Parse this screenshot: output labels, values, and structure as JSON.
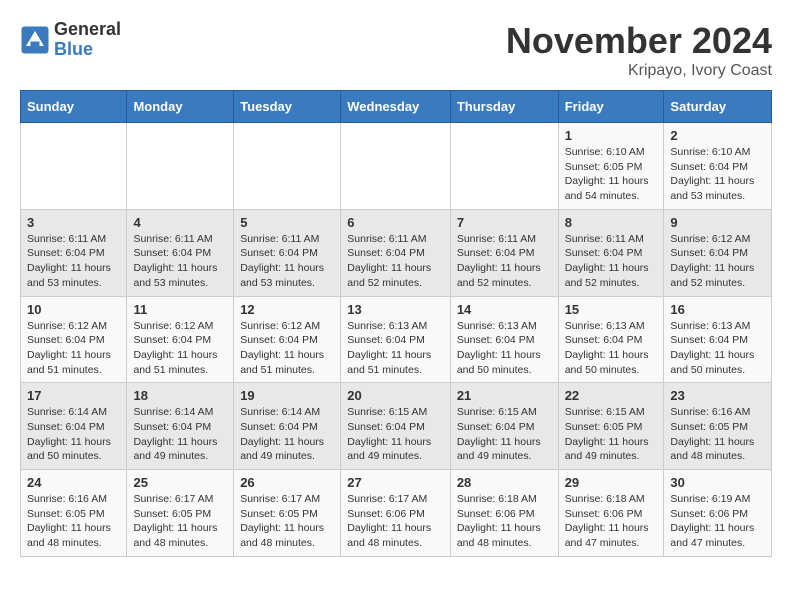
{
  "logo": {
    "general": "General",
    "blue": "Blue"
  },
  "title": "November 2024",
  "location": "Kripayo, Ivory Coast",
  "headers": [
    "Sunday",
    "Monday",
    "Tuesday",
    "Wednesday",
    "Thursday",
    "Friday",
    "Saturday"
  ],
  "weeks": [
    [
      {
        "day": "",
        "detail": ""
      },
      {
        "day": "",
        "detail": ""
      },
      {
        "day": "",
        "detail": ""
      },
      {
        "day": "",
        "detail": ""
      },
      {
        "day": "",
        "detail": ""
      },
      {
        "day": "1",
        "detail": "Sunrise: 6:10 AM\nSunset: 6:05 PM\nDaylight: 11 hours and 54 minutes."
      },
      {
        "day": "2",
        "detail": "Sunrise: 6:10 AM\nSunset: 6:04 PM\nDaylight: 11 hours and 53 minutes."
      }
    ],
    [
      {
        "day": "3",
        "detail": "Sunrise: 6:11 AM\nSunset: 6:04 PM\nDaylight: 11 hours and 53 minutes."
      },
      {
        "day": "4",
        "detail": "Sunrise: 6:11 AM\nSunset: 6:04 PM\nDaylight: 11 hours and 53 minutes."
      },
      {
        "day": "5",
        "detail": "Sunrise: 6:11 AM\nSunset: 6:04 PM\nDaylight: 11 hours and 53 minutes."
      },
      {
        "day": "6",
        "detail": "Sunrise: 6:11 AM\nSunset: 6:04 PM\nDaylight: 11 hours and 52 minutes."
      },
      {
        "day": "7",
        "detail": "Sunrise: 6:11 AM\nSunset: 6:04 PM\nDaylight: 11 hours and 52 minutes."
      },
      {
        "day": "8",
        "detail": "Sunrise: 6:11 AM\nSunset: 6:04 PM\nDaylight: 11 hours and 52 minutes."
      },
      {
        "day": "9",
        "detail": "Sunrise: 6:12 AM\nSunset: 6:04 PM\nDaylight: 11 hours and 52 minutes."
      }
    ],
    [
      {
        "day": "10",
        "detail": "Sunrise: 6:12 AM\nSunset: 6:04 PM\nDaylight: 11 hours and 51 minutes."
      },
      {
        "day": "11",
        "detail": "Sunrise: 6:12 AM\nSunset: 6:04 PM\nDaylight: 11 hours and 51 minutes."
      },
      {
        "day": "12",
        "detail": "Sunrise: 6:12 AM\nSunset: 6:04 PM\nDaylight: 11 hours and 51 minutes."
      },
      {
        "day": "13",
        "detail": "Sunrise: 6:13 AM\nSunset: 6:04 PM\nDaylight: 11 hours and 51 minutes."
      },
      {
        "day": "14",
        "detail": "Sunrise: 6:13 AM\nSunset: 6:04 PM\nDaylight: 11 hours and 50 minutes."
      },
      {
        "day": "15",
        "detail": "Sunrise: 6:13 AM\nSunset: 6:04 PM\nDaylight: 11 hours and 50 minutes."
      },
      {
        "day": "16",
        "detail": "Sunrise: 6:13 AM\nSunset: 6:04 PM\nDaylight: 11 hours and 50 minutes."
      }
    ],
    [
      {
        "day": "17",
        "detail": "Sunrise: 6:14 AM\nSunset: 6:04 PM\nDaylight: 11 hours and 50 minutes."
      },
      {
        "day": "18",
        "detail": "Sunrise: 6:14 AM\nSunset: 6:04 PM\nDaylight: 11 hours and 49 minutes."
      },
      {
        "day": "19",
        "detail": "Sunrise: 6:14 AM\nSunset: 6:04 PM\nDaylight: 11 hours and 49 minutes."
      },
      {
        "day": "20",
        "detail": "Sunrise: 6:15 AM\nSunset: 6:04 PM\nDaylight: 11 hours and 49 minutes."
      },
      {
        "day": "21",
        "detail": "Sunrise: 6:15 AM\nSunset: 6:04 PM\nDaylight: 11 hours and 49 minutes."
      },
      {
        "day": "22",
        "detail": "Sunrise: 6:15 AM\nSunset: 6:05 PM\nDaylight: 11 hours and 49 minutes."
      },
      {
        "day": "23",
        "detail": "Sunrise: 6:16 AM\nSunset: 6:05 PM\nDaylight: 11 hours and 48 minutes."
      }
    ],
    [
      {
        "day": "24",
        "detail": "Sunrise: 6:16 AM\nSunset: 6:05 PM\nDaylight: 11 hours and 48 minutes."
      },
      {
        "day": "25",
        "detail": "Sunrise: 6:17 AM\nSunset: 6:05 PM\nDaylight: 11 hours and 48 minutes."
      },
      {
        "day": "26",
        "detail": "Sunrise: 6:17 AM\nSunset: 6:05 PM\nDaylight: 11 hours and 48 minutes."
      },
      {
        "day": "27",
        "detail": "Sunrise: 6:17 AM\nSunset: 6:06 PM\nDaylight: 11 hours and 48 minutes."
      },
      {
        "day": "28",
        "detail": "Sunrise: 6:18 AM\nSunset: 6:06 PM\nDaylight: 11 hours and 48 minutes."
      },
      {
        "day": "29",
        "detail": "Sunrise: 6:18 AM\nSunset: 6:06 PM\nDaylight: 11 hours and 47 minutes."
      },
      {
        "day": "30",
        "detail": "Sunrise: 6:19 AM\nSunset: 6:06 PM\nDaylight: 11 hours and 47 minutes."
      }
    ]
  ]
}
